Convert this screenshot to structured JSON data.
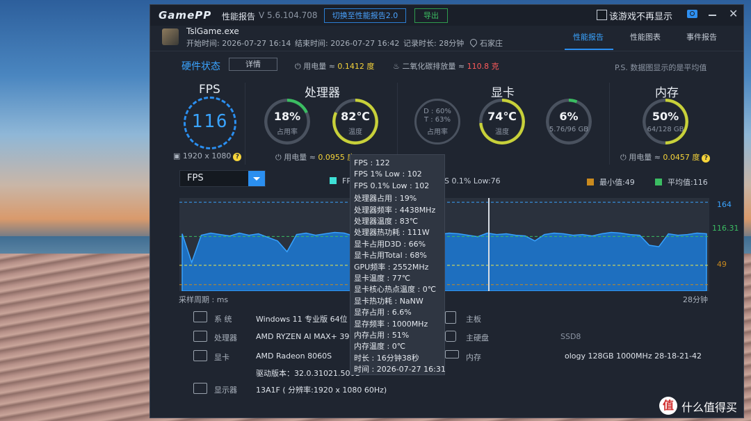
{
  "titlebar": {
    "logo": "GamePP",
    "title": "性能报告",
    "version": "V 5.6.104.708",
    "switch_btn": "切换至性能报告2.0",
    "export_btn": "导出",
    "checkbox_label": "该游戏不再显示",
    "minimize": "—",
    "close": "✕"
  },
  "session": {
    "game": "TslGame.exe",
    "start": "开始时间: 2026-07-27 16:14",
    "end": "结束时间: 2026-07-27 16:42",
    "duration": "记录时长: 28分钟",
    "location": "石家庄"
  },
  "tabs": [
    "性能报告",
    "性能图表",
    "事件报告"
  ],
  "hardware": {
    "title": "硬件状态",
    "detail_btn": "详情",
    "power_label": "用电量 ≈",
    "power_value": "0.1412 度",
    "co2_label": "二氧化碳排放量 ≈",
    "co2_value": "110.8 克",
    "note": "P.S. 数据图显示的是平均值"
  },
  "sections": {
    "fps": {
      "title": "FPS",
      "value": "116",
      "resolution": "1920 x 1080"
    },
    "cpu": {
      "title": "处理器",
      "usage": "18%",
      "usage_label": "占用率",
      "temp": "82℃",
      "temp_label": "温度",
      "power": "用电量 ≈",
      "power_value": "0.0955 度",
      "usage_frac": 0.18,
      "temp_frac": 0.82
    },
    "gpu": {
      "title": "显卡",
      "d_line": "D : 60%",
      "t_line": "T : 63%",
      "usage_label": "占用率",
      "temp": "74℃",
      "temp_label": "温度",
      "vram": "6%",
      "vram_sub": "5.76/96 GB",
      "temp_frac": 0.74,
      "vram_frac": 0.06
    },
    "mem": {
      "title": "内存",
      "usage": "50%",
      "usage_sub": "64/128 GB",
      "power": "用电量 ≈",
      "power_value": "0.0457 度",
      "usage_frac": 0.5
    }
  },
  "chart": {
    "selector": "FPS",
    "legend": [
      {
        "label": "FPS 1% Low:76",
        "color": "#3ee0d6"
      },
      {
        "label": "FPS 0.1% Low:76",
        "color": "#f1e94a"
      },
      {
        "label": "最小值:49",
        "color": "#c98a1e"
      },
      {
        "label": "平均值:116",
        "color": "#3bbd62"
      }
    ],
    "max_label": "164",
    "avg_label": "116.31",
    "min_label": "49",
    "x_label": "采样周期 : ms",
    "x_end": "28分钟"
  },
  "chart_data": {
    "type": "area",
    "series": [
      {
        "name": "FPS",
        "values": [
          120,
          80,
          118,
          121,
          119,
          117,
          121,
          118,
          120,
          115,
          110,
          95,
          119,
          121,
          118,
          120,
          122,
          121,
          117,
          105,
          118,
          120,
          119,
          121,
          118,
          120,
          117,
          119,
          121,
          120,
          118,
          116,
          121,
          119,
          120,
          118,
          117,
          110,
          119,
          121,
          120,
          118,
          119,
          117,
          120,
          122,
          121,
          119,
          118,
          104,
          102,
          120,
          118,
          119,
          121,
          120
        ]
      }
    ],
    "ylim": [
      40,
      170
    ],
    "max": 164,
    "avg": 116.31,
    "min": 49,
    "low1": 76,
    "low01": 76
  },
  "system": [
    {
      "key": "系  统",
      "value": "Windows 11 专业版 64位 26200.8875 (25H2)"
    },
    {
      "key": "处理器",
      "value": "AMD RYZEN AI MAX+ 395"
    },
    {
      "key": "显卡",
      "value": "AMD Radeon 8060S"
    },
    {
      "key": "",
      "value": "驱动版本：32.0.31021.5001"
    },
    {
      "key": "显示器",
      "value": "13A1F ( 分辨率:1920 x 1080 60Hz)"
    }
  ],
  "system_right": [
    {
      "key": "主板",
      "value": ""
    },
    {
      "key": "主硬盘",
      "value": "SSD8"
    },
    {
      "key": "内存",
      "value": "ology 128GB 1000MHz 28-18-21-42"
    }
  ],
  "tooltip": [
    "FPS : 122",
    "FPS 1% Low : 102",
    "FPS 0.1% Low : 102",
    "处理器占用 : 19%",
    "处理器频率 : 4438MHz",
    "处理器温度 : 83℃",
    "处理器热功耗 : 111W",
    "显卡占用D3D : 66%",
    "显卡占用Total : 68%",
    "GPU频率 : 2552MHz",
    "显卡温度 : 77℃",
    "显卡核心热点温度 : 0℃",
    "显卡热功耗 : NaNW",
    "显存占用 : 6.6%",
    "显存频率 : 1000MHz",
    "内存占用 : 51%",
    "内存温度 : 0℃",
    "时长 : 16分钟38秒",
    "时间 : 2026-07-27 16:31"
  ],
  "watermark": "什么值得买",
  "watermark_icon": "值"
}
